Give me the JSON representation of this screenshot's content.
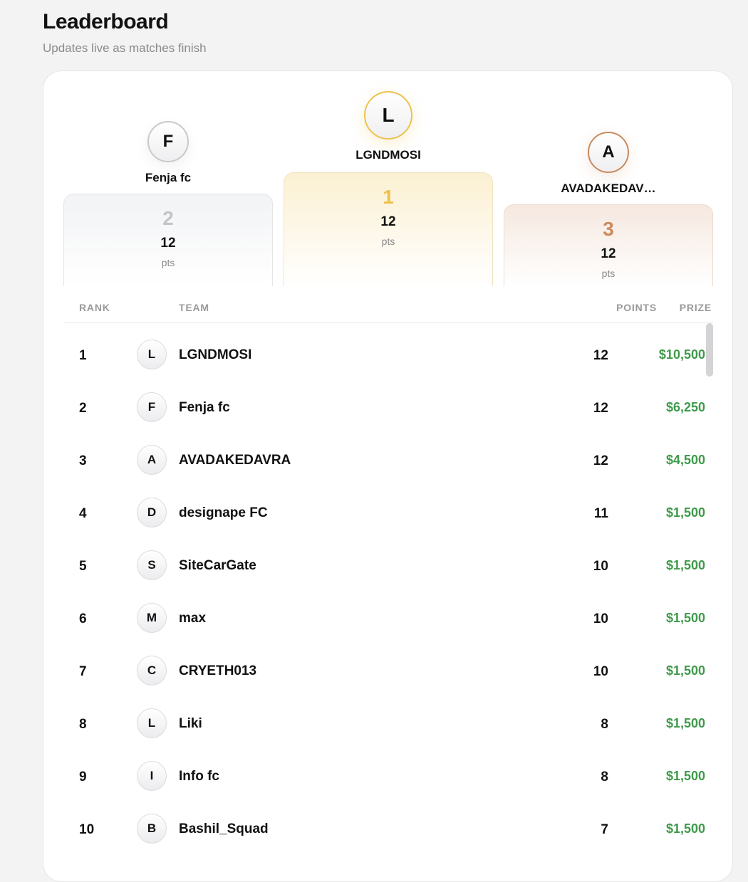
{
  "header": {
    "title": "Leaderboard",
    "subtitle": "Updates live as matches finish"
  },
  "podium": {
    "first": {
      "initial": "L",
      "name": "LGNDMOSI",
      "rank": "1",
      "points": "12",
      "unit": "pts"
    },
    "second": {
      "initial": "F",
      "name": "Fenja fc",
      "rank": "2",
      "points": "12",
      "unit": "pts"
    },
    "third": {
      "initial": "A",
      "name": "AVADAKEDAV…",
      "rank": "3",
      "points": "12",
      "unit": "pts"
    }
  },
  "table": {
    "columns": {
      "rank": "RANK",
      "team": "TEAM",
      "points": "POINTS",
      "prize": "PRIZE"
    },
    "rows": [
      {
        "rank": "1",
        "initial": "L",
        "team": "LGNDMOSI",
        "points": "12",
        "prize": "$10,500"
      },
      {
        "rank": "2",
        "initial": "F",
        "team": "Fenja fc",
        "points": "12",
        "prize": "$6,250"
      },
      {
        "rank": "3",
        "initial": "A",
        "team": "AVADAKEDAVRA",
        "points": "12",
        "prize": "$4,500"
      },
      {
        "rank": "4",
        "initial": "D",
        "team": "designape FC",
        "points": "11",
        "prize": "$1,500"
      },
      {
        "rank": "5",
        "initial": "S",
        "team": "SiteCarGate",
        "points": "10",
        "prize": "$1,500"
      },
      {
        "rank": "6",
        "initial": "M",
        "team": "max",
        "points": "10",
        "prize": "$1,500"
      },
      {
        "rank": "7",
        "initial": "C",
        "team": "CRYETH013",
        "points": "10",
        "prize": "$1,500"
      },
      {
        "rank": "8",
        "initial": "L",
        "team": "Liki",
        "points": "8",
        "prize": "$1,500"
      },
      {
        "rank": "9",
        "initial": "I",
        "team": "Info fc",
        "points": "8",
        "prize": "$1,500"
      },
      {
        "rank": "10",
        "initial": "B",
        "team": "Bashil_Squad",
        "points": "7",
        "prize": "$1,500"
      }
    ]
  },
  "colors": {
    "gold": "#efc04d",
    "silver": "#c4c5c9",
    "bronze": "#cc8b5c",
    "prize": "#3e9a4a"
  }
}
